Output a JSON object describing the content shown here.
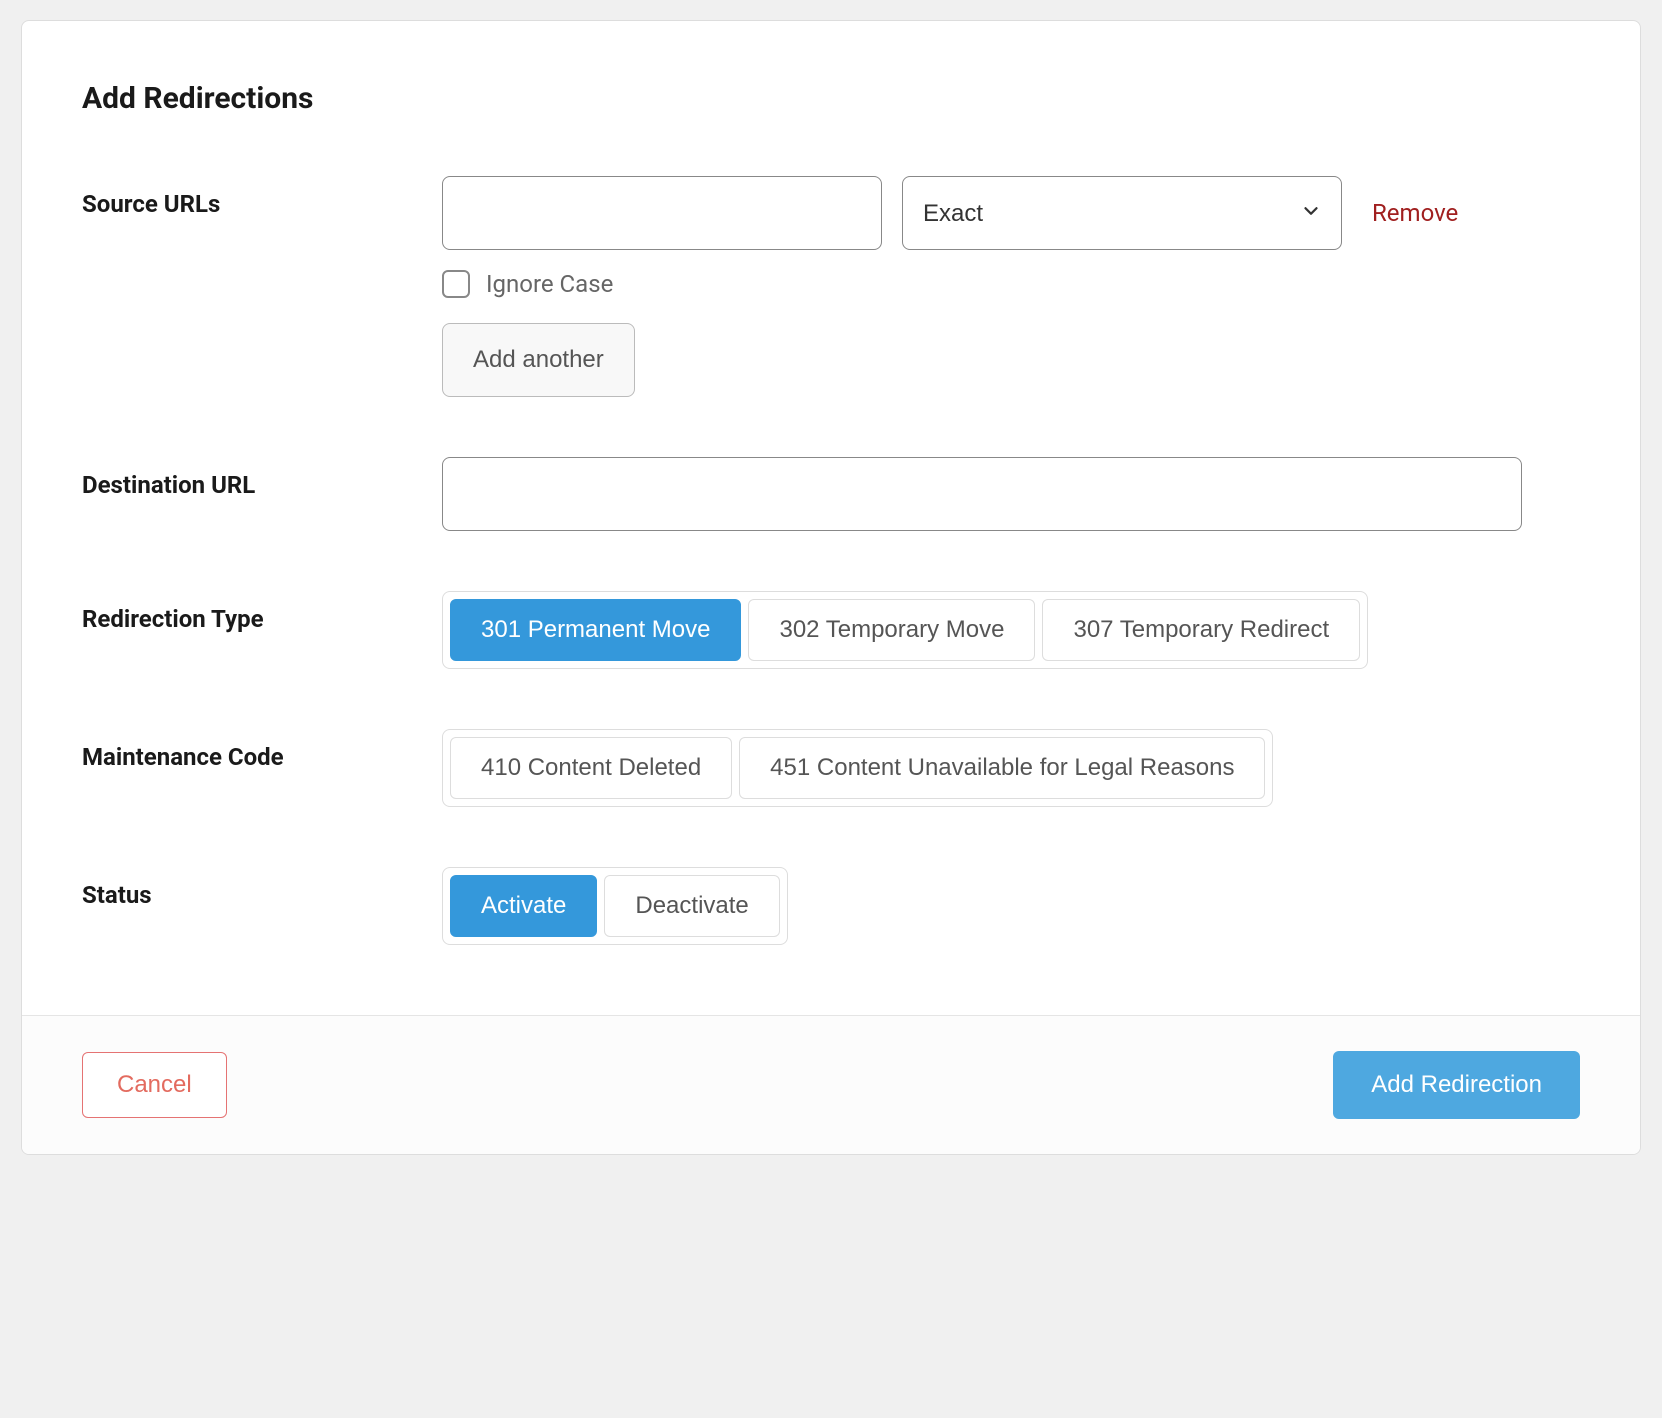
{
  "title": "Add Redirections",
  "labels": {
    "source_urls": "Source URLs",
    "destination_url": "Destination URL",
    "redirection_type": "Redirection Type",
    "maintenance_code": "Maintenance Code",
    "status": "Status"
  },
  "source": {
    "url_value": "",
    "match_type": "Exact",
    "remove": "Remove",
    "ignore_case": "Ignore Case",
    "add_another": "Add another"
  },
  "destination": {
    "value": ""
  },
  "redirection_type": {
    "options": [
      {
        "label": "301 Permanent Move",
        "active": true
      },
      {
        "label": "302 Temporary Move",
        "active": false
      },
      {
        "label": "307 Temporary Redirect",
        "active": false
      }
    ]
  },
  "maintenance_code": {
    "options": [
      {
        "label": "410 Content Deleted",
        "active": false
      },
      {
        "label": "451 Content Unavailable for Legal Reasons",
        "active": false
      }
    ]
  },
  "status": {
    "options": [
      {
        "label": "Activate",
        "active": true
      },
      {
        "label": "Deactivate",
        "active": false
      }
    ]
  },
  "footer": {
    "cancel": "Cancel",
    "submit": "Add Redirection"
  }
}
